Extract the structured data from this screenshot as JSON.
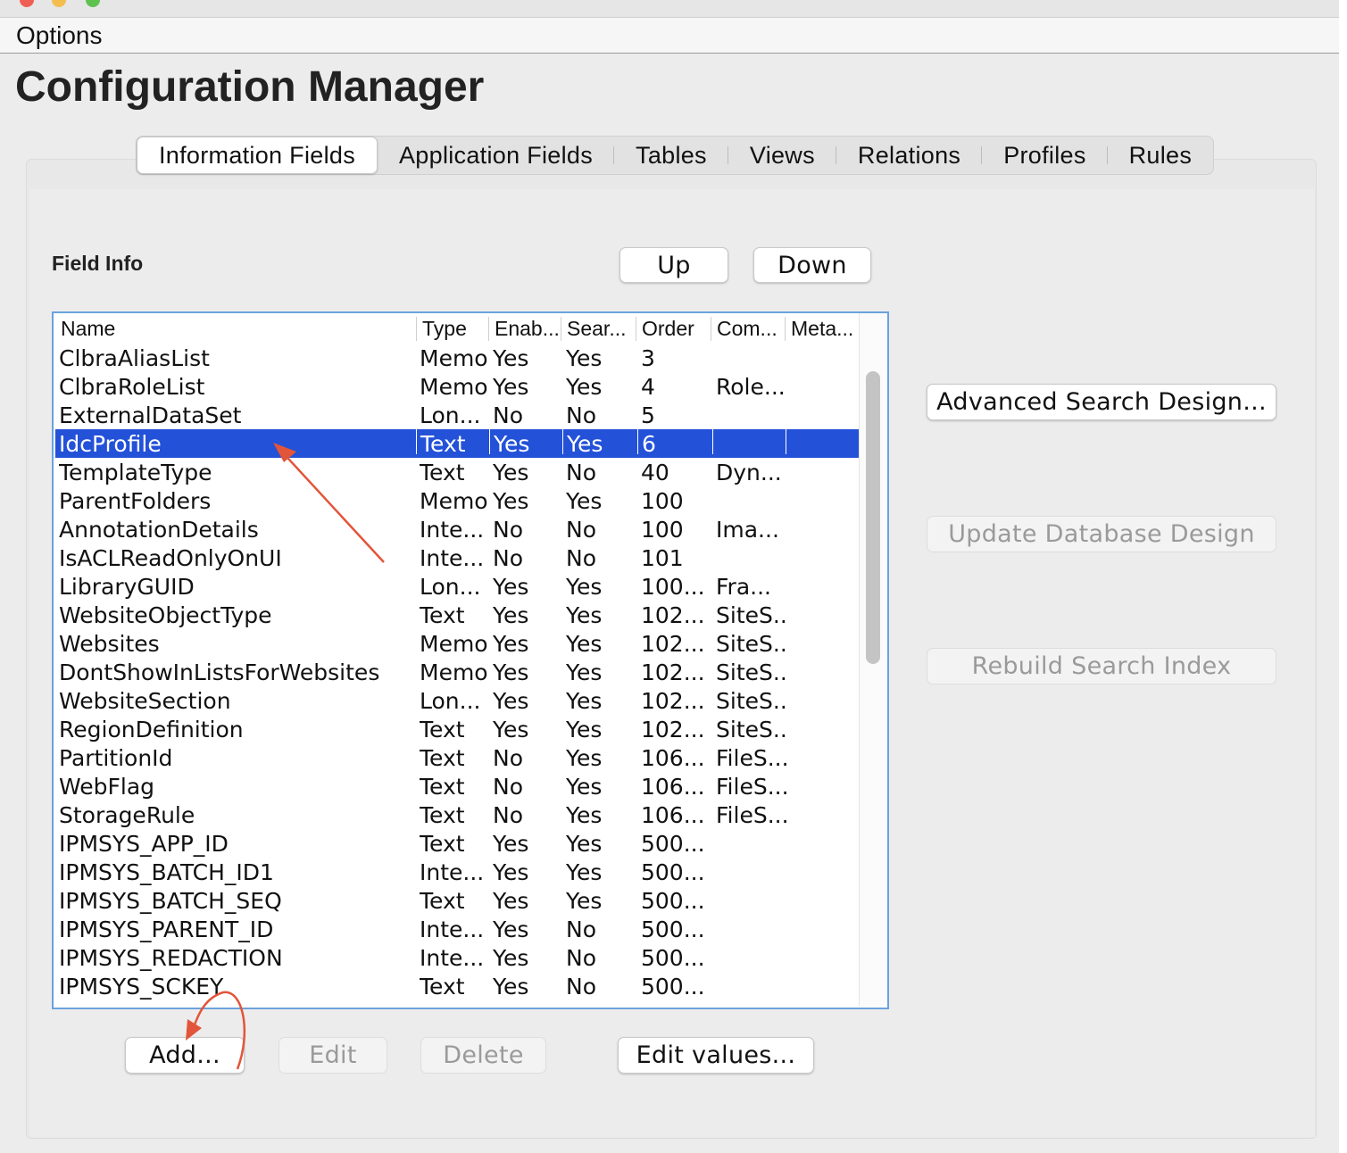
{
  "menu": {
    "options": "Options"
  },
  "header": {
    "title": "Configuration Manager"
  },
  "tabs": [
    {
      "label": "Information Fields",
      "active": true
    },
    {
      "label": "Application Fields"
    },
    {
      "label": "Tables"
    },
    {
      "label": "Views"
    },
    {
      "label": "Relations"
    },
    {
      "label": "Profiles"
    },
    {
      "label": "Rules"
    }
  ],
  "field_info": {
    "label": "Field Info",
    "up_label": "Up",
    "down_label": "Down"
  },
  "table": {
    "columns": [
      "Name",
      "Type",
      "Enab...",
      "Sear...",
      "Order",
      "Com...",
      "Meta..."
    ],
    "selected_row": 3,
    "rows": [
      [
        "ClbraAliasList",
        "Memo",
        "Yes",
        "Yes",
        "3",
        "",
        ""
      ],
      [
        "ClbraRoleList",
        "Memo",
        "Yes",
        "Yes",
        "4",
        "Role...",
        ""
      ],
      [
        "ExternalDataSet",
        "Lon...",
        "No",
        "No",
        "5",
        "",
        ""
      ],
      [
        "IdcProfile",
        "Text",
        "Yes",
        "Yes",
        "6",
        "",
        ""
      ],
      [
        "TemplateType",
        "Text",
        "Yes",
        "No",
        "40",
        "Dyn...",
        ""
      ],
      [
        "ParentFolders",
        "Memo",
        "Yes",
        "Yes",
        "100",
        "",
        ""
      ],
      [
        "AnnotationDetails",
        "Inte...",
        "No",
        "No",
        "100",
        "Ima...",
        ""
      ],
      [
        "IsACLReadOnlyOnUI",
        "Inte...",
        "No",
        "No",
        "101",
        "",
        ""
      ],
      [
        "LibraryGUID",
        "Lon...",
        "Yes",
        "Yes",
        "100...",
        "Fra...",
        ""
      ],
      [
        "WebsiteObjectType",
        "Text",
        "Yes",
        "Yes",
        "102...",
        "SiteS...",
        ""
      ],
      [
        "Websites",
        "Memo",
        "Yes",
        "Yes",
        "102...",
        "SiteS...",
        ""
      ],
      [
        "DontShowInListsForWebsites",
        "Memo",
        "Yes",
        "Yes",
        "102...",
        "SiteS...",
        ""
      ],
      [
        "WebsiteSection",
        "Lon...",
        "Yes",
        "Yes",
        "102...",
        "SiteS...",
        ""
      ],
      [
        "RegionDefinition",
        "Text",
        "Yes",
        "Yes",
        "102...",
        "SiteS...",
        ""
      ],
      [
        "PartitionId",
        "Text",
        "No",
        "Yes",
        "106...",
        "FileS...",
        ""
      ],
      [
        "WebFlag",
        "Text",
        "No",
        "Yes",
        "106...",
        "FileS...",
        ""
      ],
      [
        "StorageRule",
        "Text",
        "No",
        "Yes",
        "106...",
        "FileS...",
        ""
      ],
      [
        "IPMSYS_APP_ID",
        "Text",
        "Yes",
        "Yes",
        "500...",
        "",
        ""
      ],
      [
        "IPMSYS_BATCH_ID1",
        "Inte...",
        "Yes",
        "Yes",
        "500...",
        "",
        ""
      ],
      [
        "IPMSYS_BATCH_SEQ",
        "Text",
        "Yes",
        "Yes",
        "500...",
        "",
        ""
      ],
      [
        "IPMSYS_PARENT_ID",
        "Inte...",
        "Yes",
        "No",
        "500...",
        "",
        ""
      ],
      [
        "IPMSYS_REDACTION",
        "Inte...",
        "Yes",
        "No",
        "500...",
        "",
        ""
      ],
      [
        "IPMSYS_SCKEY",
        "Text",
        "Yes",
        "No",
        "500...",
        "",
        ""
      ]
    ]
  },
  "actions": {
    "add": "Add...",
    "edit": "Edit",
    "delete": "Delete",
    "edit_values": "Edit values..."
  },
  "side_actions": {
    "advanced_search": "Advanced Search Design...",
    "update_db": "Update Database Design",
    "rebuild_index": "Rebuild Search Index"
  },
  "colors": {
    "selection": "#2351d8",
    "annotation_arrow": "#e2553a",
    "table_border": "#6aa3dc"
  }
}
